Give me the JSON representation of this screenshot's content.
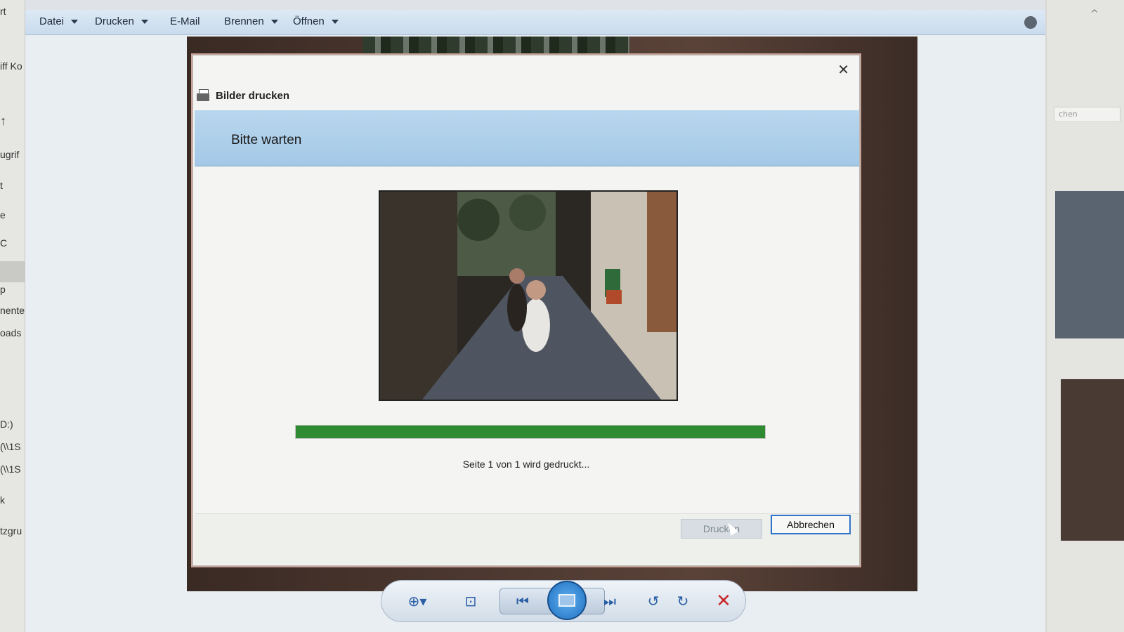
{
  "left_sidebar": {
    "fragments": [
      "rt",
      "iff Ko",
      "↑",
      "ugrif",
      "t",
      "e",
      "C",
      "p",
      "nente",
      "oads",
      "D:)",
      "(\\\\1S",
      "(\\\\1S",
      "k",
      "tzgru"
    ]
  },
  "right_window": {
    "search_placeholder": "chen"
  },
  "menubar": {
    "items": [
      {
        "label": "Datei",
        "has_dropdown": true
      },
      {
        "label": "Drucken",
        "has_dropdown": true
      },
      {
        "label": "E-Mail",
        "has_dropdown": false
      },
      {
        "label": "Brennen",
        "has_dropdown": true
      },
      {
        "label": "Öffnen",
        "has_dropdown": true
      }
    ],
    "help_icon": "help-icon"
  },
  "dialog": {
    "title": "Bilder drucken",
    "title_icon": "printer-icon",
    "close_icon": "close-icon",
    "header": "Bitte warten",
    "progress_fraction": 1.0,
    "status_text": "Seite 1 von 1 wird gedruckt...",
    "buttons": {
      "print_label": "Drucken",
      "print_enabled": false,
      "cancel_label": "Abbrechen"
    }
  },
  "toolbar": {
    "items": [
      {
        "name": "zoom-icon"
      },
      {
        "name": "fit-window-icon"
      },
      {
        "name": "previous-icon"
      },
      {
        "name": "slideshow-icon"
      },
      {
        "name": "next-icon"
      },
      {
        "name": "rotate-counterclockwise-icon"
      },
      {
        "name": "rotate-clockwise-icon"
      },
      {
        "name": "delete-icon"
      }
    ]
  },
  "colors": {
    "progress_fill": "#2e8b32",
    "header_band": "#a3c8e6",
    "cancel_border": "#2f74c8",
    "delete": "#c8282a"
  }
}
